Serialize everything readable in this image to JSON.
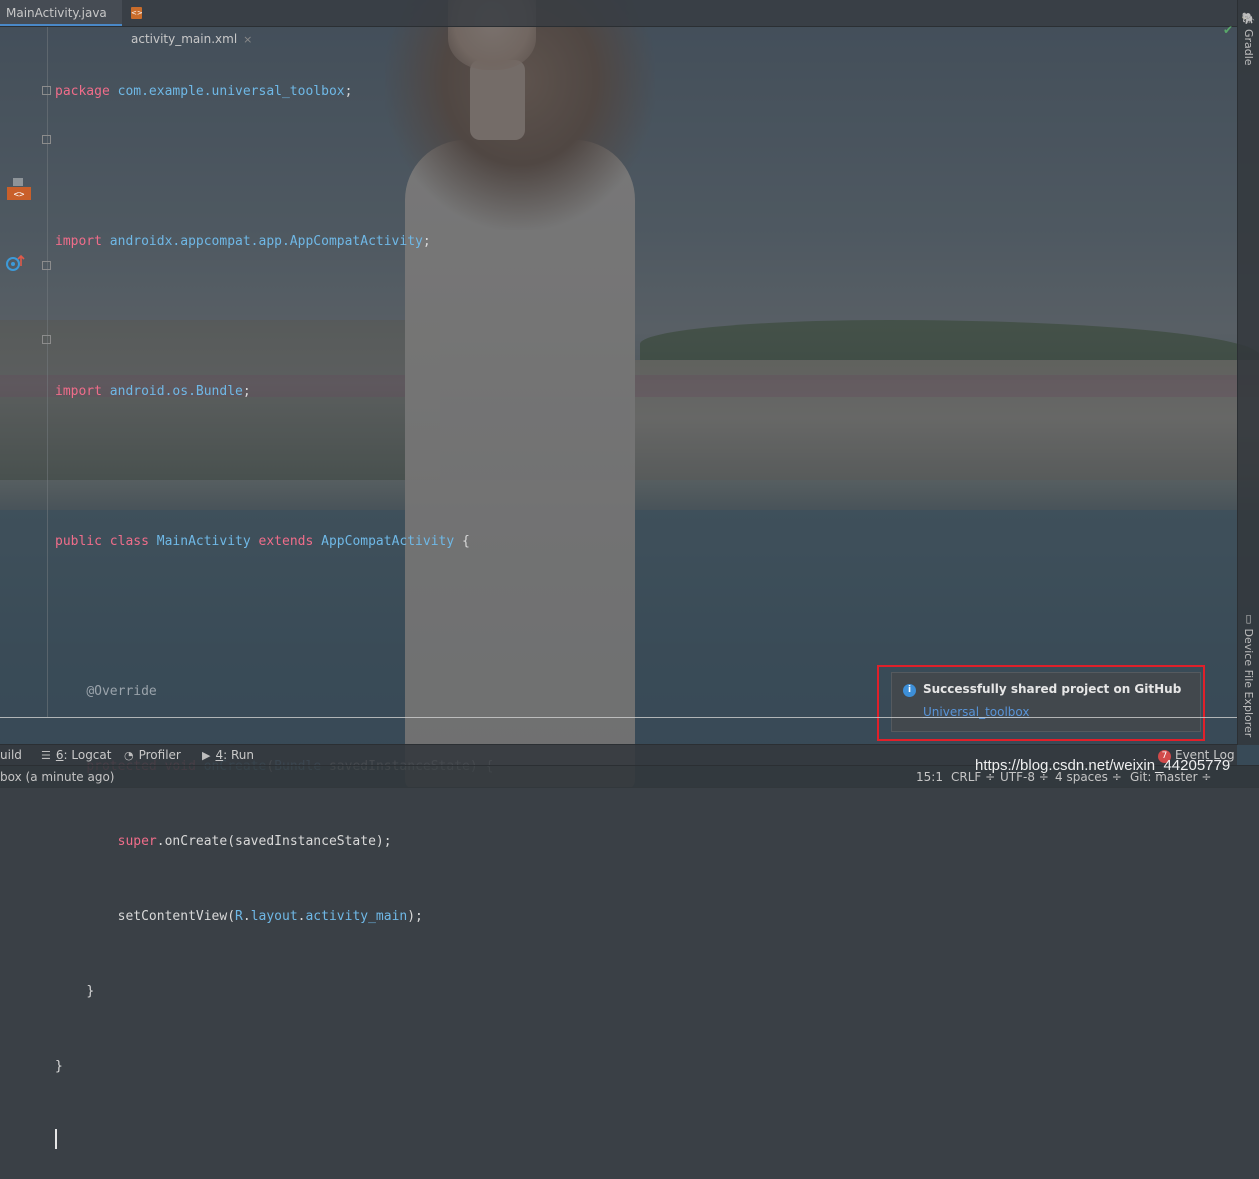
{
  "tabs": [
    {
      "label": "MainActivity.java"
    },
    {
      "label": "activity_main.xml",
      "close": "×"
    }
  ],
  "code": {
    "line1": {
      "kw": "package",
      "pkg": "com.example.universal_toolbox",
      "end": ";"
    },
    "line3": {
      "kw": "import",
      "pkg": "androidx.appcompat.app.AppCompatActivity",
      "end": ";"
    },
    "line5": {
      "kw": "import",
      "pkg": "android.os.Bundle",
      "end": ";"
    },
    "line7": {
      "kw1": "public",
      "kw2": "class",
      "name": "MainActivity",
      "kw3": "extends",
      "parent": "AppCompatActivity",
      "end": "{"
    },
    "line9": {
      "annotation": "@Override"
    },
    "line10": {
      "kw1": "protected",
      "kw2": "void",
      "method": "onCreate",
      "open": "(",
      "type": "Bundle",
      "param": "savedInstanceState",
      "close": ") {"
    },
    "line11": {
      "kw": "super",
      "rest": ".onCreate(savedInstanceState);"
    },
    "line12": {
      "call": "setContentView(",
      "r": "R",
      "dot1": ".",
      "layout": "layout",
      "dot2": ".",
      "field": "activity_main",
      "end": ");"
    },
    "line13": {
      "brace": "}"
    },
    "line14": {
      "brace": "}"
    }
  },
  "right_strip": {
    "gradle": "Gradle",
    "device_file_explorer": "Device File Explorer"
  },
  "notification": {
    "title": "Successfully shared project on GitHub",
    "link": "Universal_toolbox",
    "icon": "info-icon"
  },
  "tool_windows": {
    "build": "uild",
    "logcat_num": "6",
    "logcat_label": ": Logcat",
    "profiler": "Profiler",
    "run_num": "4",
    "run_label": ": Run",
    "event_log_count": "7",
    "event_log": "Event Log"
  },
  "status": {
    "message": "box (a minute ago)",
    "position": "15:1",
    "line_sep": "CRLF ÷",
    "encoding": "UTF-8 ÷",
    "indent": "4 spaces ÷",
    "git": "Git: master ÷"
  },
  "watermark": "https://blog.csdn.net/weixin_44205779",
  "colors": {
    "keyword": "#f06d8a",
    "type": "#6fb8e6",
    "annotation": "#9aa3ab",
    "link": "#5894d8",
    "highlight_box": "#e0202a"
  }
}
